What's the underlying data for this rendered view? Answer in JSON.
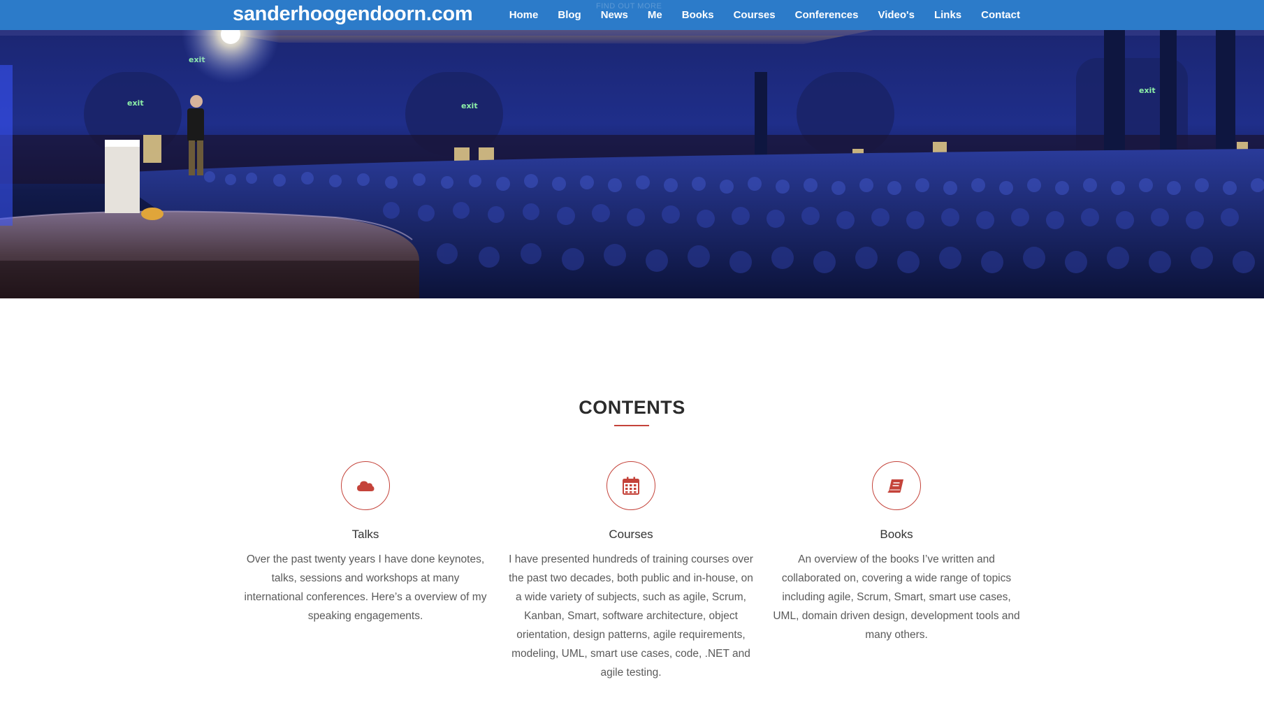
{
  "header": {
    "brand": "sanderhoogendoorn.com",
    "ghost_link": "FIND OUT MORE",
    "nav": [
      "Home",
      "Blog",
      "News",
      "Me",
      "Books",
      "Courses",
      "Conferences",
      "Video's",
      "Links",
      "Contact"
    ]
  },
  "hero": {
    "exit_signs": [
      "exit",
      "exit",
      "exit",
      "exit"
    ]
  },
  "contents": {
    "title": "CONTENTS",
    "features": [
      {
        "icon": "cloud-icon",
        "heading": "Talks",
        "text": "Over the past twenty years I have done keynotes, talks, sessions and workshops at many international conferences. Here’s a overview of my speaking engagements."
      },
      {
        "icon": "calendar-icon",
        "heading": "Courses",
        "text": "I have presented hundreds of training courses over the past two decades, both public and in-house, on a wide variety of subjects, such as agile, Scrum, Kanban, Smart, software architecture, object orientation, design patterns, agile requirements, modeling, UML, smart use cases, code, .NET and agile testing."
      },
      {
        "icon": "book-icon",
        "heading": "Books",
        "text": "An overview of the books I’ve written and collaborated on, covering a wide range of topics including agile, Scrum, Smart, smart use cases, UML, domain driven design, development tools and many others."
      }
    ]
  },
  "colors": {
    "navbar": "#2c7bc9",
    "accent": "#c4433a",
    "heading": "#2b2b2b",
    "body_text": "#5a5a5a"
  }
}
